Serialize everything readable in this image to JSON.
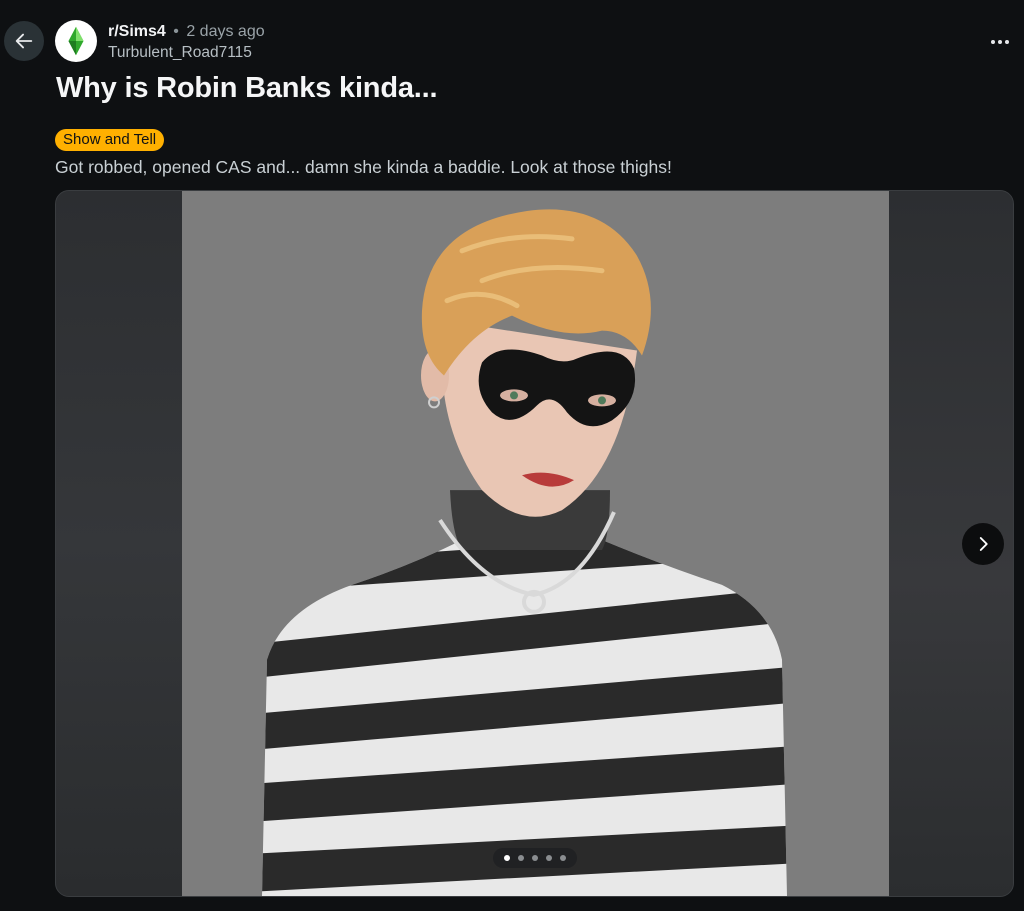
{
  "post": {
    "subreddit": "r/Sims4",
    "separator": "•",
    "time_ago": "2 days ago",
    "author": "Turbulent_Road7115",
    "title": "Why is Robin Banks kinda...",
    "flair": "Show and Tell",
    "body": "Got robbed, opened CAS and... damn she kinda a baddie. Look at those thighs!"
  },
  "gallery": {
    "current_slide": 1,
    "total_slides": 5
  },
  "icons": {
    "back": "arrow-left-icon",
    "more": "more-horizontal-icon",
    "next": "chevron-right-icon",
    "subreddit": "plumbob-icon"
  },
  "colors": {
    "background": "#0e1012",
    "flair": "#ffb000",
    "plumbob": "#3fbf3a"
  }
}
